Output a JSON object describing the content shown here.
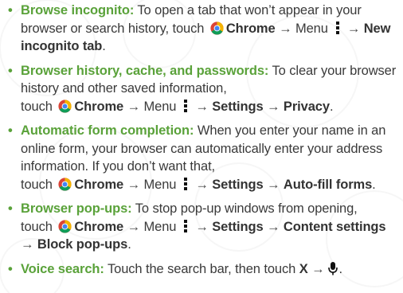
{
  "items": [
    {
      "bullet": "•",
      "title": "Browse incognito:",
      "text1": " To open a tab that won’t appear in your browser or search history, touch",
      "chrome": "Chrome",
      "arrow1": "→",
      "menu": "Menu",
      "arrow2": "→",
      "end": "New incognito tab",
      "period": "."
    },
    {
      "bullet": "•",
      "title": "Browser history, cache, and passwords:",
      "text1": " To clear your browser history and other saved information,",
      "touch": "touch",
      "chrome": "Chrome",
      "arrow1": "→",
      "menu": "Menu",
      "arrow2": "→",
      "settings": "Settings",
      "arrow3": "→",
      "end": "Privacy",
      "period": "."
    },
    {
      "bullet": "•",
      "title": "Automatic form completion:",
      "text1": " When you enter your name in an online form, your browser can automatically enter your address information. If you don’t want that,",
      "touch": "touch",
      "chrome": "Chrome",
      "arrow1": "→",
      "menu": "Menu",
      "arrow2": "→",
      "settings": "Settings",
      "arrow3": "→",
      "end": "Auto-fill forms",
      "period": "."
    },
    {
      "bullet": "•",
      "title": "Browser pop-ups:",
      "text1": " To stop pop-up windows from opening,",
      "touch": "touch",
      "chrome": "Chrome",
      "arrow1": "→",
      "menu": "Menu",
      "arrow2": "→",
      "settings": "Settings",
      "arrow3": "→",
      "content": "Content settings",
      "arrow4": "→",
      "end": "Block pop-ups",
      "period": "."
    },
    {
      "bullet": "•",
      "title": "Voice search:",
      "text1": " Touch the search bar, then touch",
      "x": "X",
      "arrow1": "→",
      "period": "."
    }
  ],
  "colors": {
    "accent": "#5aa23a",
    "text": "#3a3a3a"
  },
  "icons": [
    "chrome-icon",
    "menu-icon",
    "mic-icon"
  ]
}
